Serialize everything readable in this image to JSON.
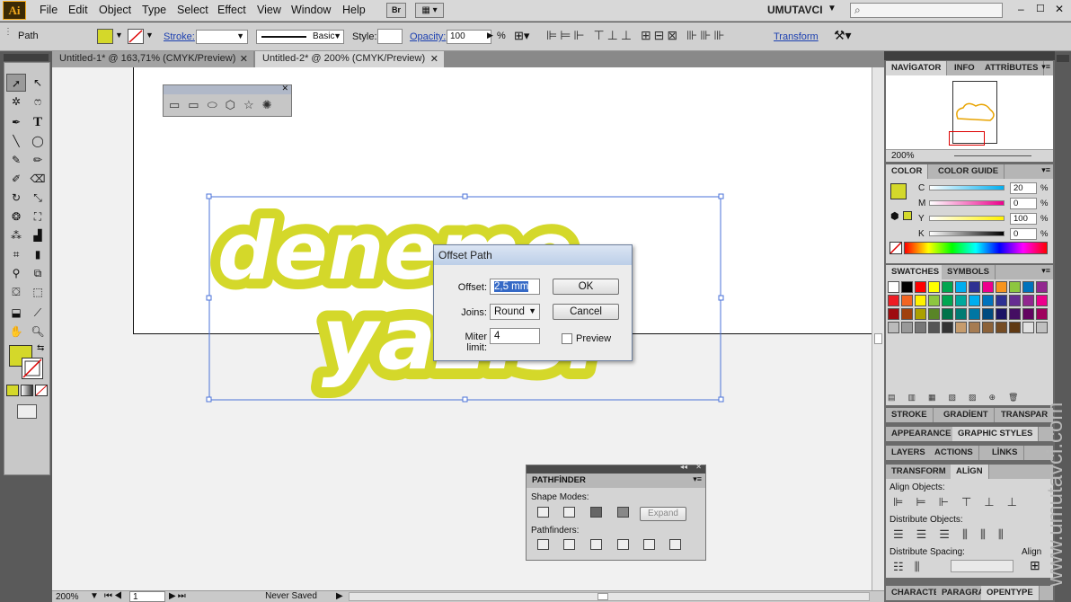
{
  "app": {
    "logo": "Ai",
    "workspace": "UMUTAVCI"
  },
  "menu": [
    "File",
    "Edit",
    "Object",
    "Type",
    "Select",
    "Effect",
    "View",
    "Window",
    "Help"
  ],
  "menu_extra": {
    "bridge": "Br"
  },
  "controlbar": {
    "selection_type": "Path",
    "stroke_label": "Stroke:",
    "brush_label": "Basic",
    "style_label": "Style:",
    "opacity_label": "Opacity:",
    "opacity_value": "100",
    "percent": "%",
    "transform_link": "Transform"
  },
  "tabs": [
    {
      "label": "Untitled-1* @ 163,71% (CMYK/Preview)"
    },
    {
      "label": "Untitled-2* @ 200% (CMYK/Preview)"
    }
  ],
  "artwork": {
    "line1": "deneme",
    "line2": "yazısı",
    "fill_color": "#d4d82a"
  },
  "dialog": {
    "title": "Offset Path",
    "offset_label": "Offset:",
    "offset_value": "2,5 mm",
    "joins_label": "Joins:",
    "joins_value": "Round",
    "miter_label": "Miter limit:",
    "miter_value": "4",
    "ok": "OK",
    "cancel": "Cancel",
    "preview": "Preview"
  },
  "pathfinder": {
    "title": "PATHFİNDER",
    "shape_modes": "Shape Modes:",
    "expand": "Expand",
    "pathfinders": "Pathfinders:"
  },
  "navigator": {
    "tabs": [
      "NAVİGATOR",
      "INFO",
      "ATTRİBUTES"
    ],
    "zoom": "200%"
  },
  "color": {
    "tabs": [
      "COLOR",
      "COLOR GUIDE"
    ],
    "channels": [
      {
        "name": "C",
        "value": "20"
      },
      {
        "name": "M",
        "value": "0"
      },
      {
        "name": "Y",
        "value": "100"
      },
      {
        "name": "K",
        "value": "0"
      }
    ],
    "percent": "%"
  },
  "swatches": {
    "tabs": [
      "SWATCHES",
      "SYMBOLS"
    ]
  },
  "panels": {
    "stroke_row": [
      "STROKE",
      "GRADİENT",
      "TRANSPAR"
    ],
    "appearance_row": [
      "APPEARANCE",
      "GRAPHIC STYLES"
    ],
    "layers_row": [
      "LAYERS",
      "ACTIONS",
      "LİNKS"
    ],
    "transform_row": [
      "TRANSFORM",
      "ALİGN"
    ],
    "align_objects": "Align Objects:",
    "distribute_objects": "Distribute Objects:",
    "distribute_spacing": "Distribute Spacing:",
    "align_to": "Align",
    "bottom_row": [
      "CHARACTE",
      "PARAGRA",
      "OPENTYPE"
    ]
  },
  "status": {
    "zoom": "200%",
    "page": "1",
    "state": "Never Saved"
  },
  "watermark": "www.umutavci.com"
}
